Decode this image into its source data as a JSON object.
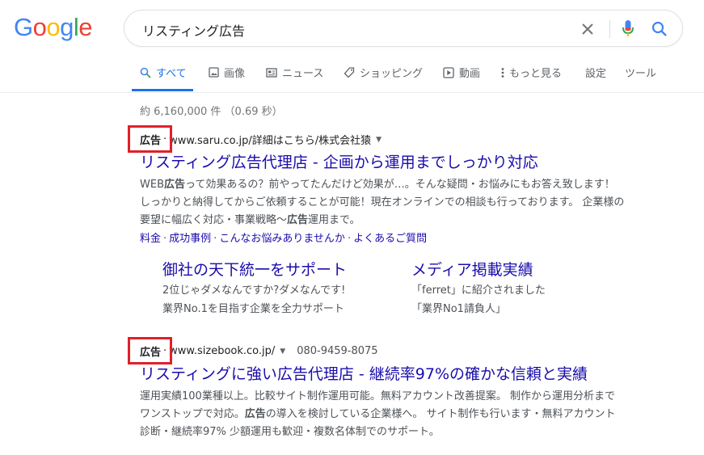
{
  "logo": {
    "letters": [
      "G",
      "o",
      "o",
      "g",
      "l",
      "e"
    ],
    "colors": [
      "#4285f4",
      "#ea4335",
      "#fbbc05",
      "#4285f4",
      "#34a853",
      "#ea4335"
    ]
  },
  "search": {
    "query": "リスティング広告"
  },
  "tabs": [
    {
      "label": "すべて",
      "icon": "search-icon",
      "active": true
    },
    {
      "label": "画像",
      "icon": "image-icon"
    },
    {
      "label": "ニュース",
      "icon": "news-icon"
    },
    {
      "label": "ショッピング",
      "icon": "tag-icon"
    },
    {
      "label": "動画",
      "icon": "video-icon"
    },
    {
      "label": "もっと見る",
      "icon": "more-vert-icon"
    },
    {
      "label": "設定"
    },
    {
      "label": "ツール"
    }
  ],
  "stats": "約 6,160,000 件 （0.69 秒）",
  "results": [
    {
      "badge": "広告",
      "url": "www.saru.co.jp/詳細はこちら/株式会社猿",
      "title": "リスティング広告代理店 - 企画から運用までしっかり対応",
      "snippet": [
        {
          "t": "WEB"
        },
        {
          "t": "広告",
          "b": true
        },
        {
          "t": "って効果あるの？前やってたんだけど効果が…。そんな疑問・お悩みにもお答え致します！ しっかりと納得してからご依頼することが可能！現在オンラインでの相談も行っております。 企業様の要望に幅広く対応・事業戦略～"
        },
        {
          "t": "広告",
          "b": true
        },
        {
          "t": "運用まで。"
        }
      ],
      "inline_links": [
        "料金",
        "成功事例",
        "こんなお悩みありませんか",
        "よくあるご質問"
      ],
      "sitelinks": [
        {
          "title": "御社の天下統一をサポート",
          "desc": [
            "2位じゃダメなんですか?ダメなんです!",
            "業界No.1を目指す企業を全力サポート"
          ]
        },
        {
          "title": "メディア掲載実績",
          "desc": [
            "「ferret」に紹介されました",
            "「業界No1請負人」"
          ]
        }
      ]
    },
    {
      "badge": "広告",
      "url": "www.sizebook.co.jp/",
      "phone": "080-9459-8075",
      "title": "リスティングに強い広告代理店 - 継続率97%の確かな信頼と実績",
      "snippet": [
        {
          "t": "運用実績100業種以上。比較サイト制作運用可能。無料アカウント改善提案。 制作から運用分析までワンストップで対応。"
        },
        {
          "t": "広告",
          "b": true
        },
        {
          "t": "の導入を検討している企業様へ。 サイト制作も行います・無料アカウント診断・継続率97% 少額運用も歓迎・複数名体制でのサポート。"
        }
      ]
    }
  ],
  "colors": {
    "link": "#1a0dab",
    "accent": "#1a73e8",
    "highlight": "#e0202a"
  }
}
